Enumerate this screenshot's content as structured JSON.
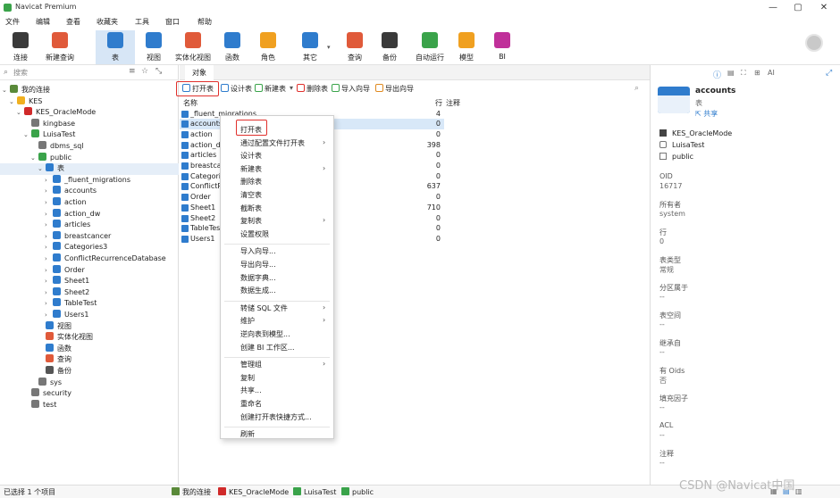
{
  "app": {
    "title": "Navicat Premium"
  },
  "menubar": [
    "文件",
    "编辑",
    "查看",
    "收藏夹",
    "工具",
    "窗口",
    "帮助"
  ],
  "toolbar": [
    {
      "label": "连接",
      "icon": "connection-plug-icon",
      "color": "#3a3a3a"
    },
    {
      "label": "新建查询",
      "icon": "new-query-icon",
      "color": "#e05a3a"
    },
    {
      "label": "表",
      "icon": "table-icon",
      "color": "#2f7ccd"
    },
    {
      "label": "视图",
      "icon": "view-glasses-icon",
      "color": "#2f7ccd"
    },
    {
      "label": "实体化视图",
      "icon": "materialized-view-icon",
      "color": "#e05a3a"
    },
    {
      "label": "函数",
      "icon": "function-fx-icon",
      "color": "#2f7ccd"
    },
    {
      "label": "角色",
      "icon": "role-user-icon",
      "color": "#f0a020"
    },
    {
      "label": "其它",
      "icon": "other-tools-icon",
      "color": "#2f7ccd"
    },
    {
      "label": "查询",
      "icon": "query-icon",
      "color": "#e05a3a"
    },
    {
      "label": "备份",
      "icon": "backup-icon",
      "color": "#3a3a3a"
    },
    {
      "label": "自动运行",
      "icon": "automation-robot-icon",
      "color": "#3aa34a"
    },
    {
      "label": "模型",
      "icon": "model-icon",
      "color": "#f0a020"
    },
    {
      "label": "BI",
      "icon": "bi-chart-icon",
      "color": "#c0309a"
    }
  ],
  "sidebar": {
    "search_placeholder": "搜索",
    "tree": [
      {
        "label": "我的连接",
        "level": 0,
        "chev": "v",
        "icon": "connections-icon",
        "color": "#5a8a3a"
      },
      {
        "label": "KES",
        "level": 1,
        "chev": "v",
        "icon": "folder-icon",
        "color": "#f0b020"
      },
      {
        "label": "KES_OracleMode",
        "level": 2,
        "chev": "v",
        "icon": "kes-server-icon",
        "color": "#d02a2a"
      },
      {
        "label": "kingbase",
        "level": 3,
        "chev": "",
        "icon": "database-icon",
        "color": "#777777"
      },
      {
        "label": "LuisaTest",
        "level": 3,
        "chev": "v",
        "icon": "database-icon",
        "color": "#3aa34a"
      },
      {
        "label": "dbms_sql",
        "level": 4,
        "chev": "",
        "icon": "schema-icon",
        "color": "#777777"
      },
      {
        "label": "public",
        "level": 4,
        "chev": "v",
        "icon": "schema-icon",
        "color": "#3aa34a"
      },
      {
        "label": "表",
        "level": 5,
        "chev": "v",
        "icon": "table-icon",
        "color": "#2f7ccd",
        "selected": true
      },
      {
        "label": "_fluent_migrations",
        "level": 6,
        "chev": ">",
        "icon": "table-icon",
        "color": "#2f7ccd"
      },
      {
        "label": "accounts",
        "level": 6,
        "chev": ">",
        "icon": "table-icon",
        "color": "#2f7ccd"
      },
      {
        "label": "action",
        "level": 6,
        "chev": ">",
        "icon": "table-icon",
        "color": "#2f7ccd"
      },
      {
        "label": "action_dw",
        "level": 6,
        "chev": ">",
        "icon": "table-icon",
        "color": "#2f7ccd"
      },
      {
        "label": "articles",
        "level": 6,
        "chev": ">",
        "icon": "table-icon",
        "color": "#2f7ccd"
      },
      {
        "label": "breastcancer",
        "level": 6,
        "chev": ">",
        "icon": "table-icon",
        "color": "#2f7ccd"
      },
      {
        "label": "Categories3",
        "level": 6,
        "chev": ">",
        "icon": "table-icon",
        "color": "#2f7ccd"
      },
      {
        "label": "ConflictRecurrenceDatabase",
        "level": 6,
        "chev": ">",
        "icon": "table-icon",
        "color": "#2f7ccd"
      },
      {
        "label": "Order",
        "level": 6,
        "chev": ">",
        "icon": "table-icon",
        "color": "#2f7ccd"
      },
      {
        "label": "Sheet1",
        "level": 6,
        "chev": ">",
        "icon": "table-icon",
        "color": "#2f7ccd"
      },
      {
        "label": "Sheet2",
        "level": 6,
        "chev": ">",
        "icon": "table-icon",
        "color": "#2f7ccd"
      },
      {
        "label": "TableTest",
        "level": 6,
        "chev": ">",
        "icon": "table-icon",
        "color": "#2f7ccd"
      },
      {
        "label": "Users1",
        "level": 6,
        "chev": ">",
        "icon": "table-icon",
        "color": "#2f7ccd"
      },
      {
        "label": "视图",
        "level": 5,
        "chev": "",
        "icon": "view-glasses-icon",
        "color": "#2f7ccd"
      },
      {
        "label": "实体化视图",
        "level": 5,
        "chev": "",
        "icon": "materialized-view-icon",
        "color": "#e05a3a"
      },
      {
        "label": "函数",
        "level": 5,
        "chev": "",
        "icon": "function-fx-icon",
        "color": "#2f7ccd"
      },
      {
        "label": "查询",
        "level": 5,
        "chev": "",
        "icon": "query-icon",
        "color": "#e05a3a"
      },
      {
        "label": "备份",
        "level": 5,
        "chev": "",
        "icon": "backup-icon",
        "color": "#555555"
      },
      {
        "label": "sys",
        "level": 4,
        "chev": "",
        "icon": "schema-icon",
        "color": "#777777"
      },
      {
        "label": "security",
        "level": 3,
        "chev": "",
        "icon": "database-icon",
        "color": "#777777"
      },
      {
        "label": "test",
        "level": 3,
        "chev": "",
        "icon": "database-icon",
        "color": "#777777"
      }
    ]
  },
  "main": {
    "tab": "对象",
    "objtoolbar": [
      {
        "label": "打开表",
        "icon": "open-table-icon",
        "color": "#2f7ccd"
      },
      {
        "label": "设计表",
        "icon": "design-table-icon",
        "color": "#2f7ccd"
      },
      {
        "label": "新建表",
        "icon": "new-table-icon",
        "color": "#3aa34a"
      },
      {
        "label": "删除表",
        "icon": "delete-table-icon",
        "color": "#e0302c"
      },
      {
        "label": "导入向导",
        "icon": "import-wizard-icon",
        "color": "#3aa34a"
      },
      {
        "label": "导出向导",
        "icon": "export-wizard-icon",
        "color": "#e08a20"
      }
    ],
    "col_name": "名称",
    "col_rows": "行",
    "col_comment": "注释",
    "rows": [
      {
        "name": "_fluent_migrations",
        "count": "4"
      },
      {
        "name": "accounts",
        "count": "0",
        "selected": true
      },
      {
        "name": "action",
        "count": "0"
      },
      {
        "name": "action_dw",
        "count": "398"
      },
      {
        "name": "articles",
        "count": "0"
      },
      {
        "name": "breastcancer",
        "count": "0"
      },
      {
        "name": "Categories3",
        "count": "0"
      },
      {
        "name": "ConflictRecurrenceDatabase",
        "count": "637"
      },
      {
        "name": "Order",
        "count": "0"
      },
      {
        "name": "Sheet1",
        "count": "710"
      },
      {
        "name": "Sheet2",
        "count": "0"
      },
      {
        "name": "TableTest",
        "count": "0"
      },
      {
        "name": "Users1",
        "count": "0"
      }
    ]
  },
  "context_menu": [
    {
      "label": "打开表"
    },
    {
      "label": "通过配置文件打开表",
      "submenu": true
    },
    {
      "label": "设计表"
    },
    {
      "label": "新建表",
      "submenu": true
    },
    {
      "label": "删除表"
    },
    {
      "label": "清空表"
    },
    {
      "label": "截断表"
    },
    {
      "label": "复制表",
      "submenu": true
    },
    {
      "label": "设置权限"
    },
    {
      "sep": true
    },
    {
      "label": "导入向导..."
    },
    {
      "label": "导出向导..."
    },
    {
      "label": "数据字典..."
    },
    {
      "label": "数据生成..."
    },
    {
      "sep": true
    },
    {
      "label": "转储 SQL 文件",
      "submenu": true
    },
    {
      "label": "维护",
      "submenu": true
    },
    {
      "label": "逆向表到模型..."
    },
    {
      "label": "创建 BI 工作区..."
    },
    {
      "sep": true
    },
    {
      "label": "管理组",
      "submenu": true
    },
    {
      "label": "复制"
    },
    {
      "label": "共享..."
    },
    {
      "label": "重命名"
    },
    {
      "label": "创建打开表快捷方式..."
    },
    {
      "sep": true
    },
    {
      "label": "刷新"
    }
  ],
  "right_panel": {
    "object_name": "accounts",
    "object_type": "表",
    "share_label": "共享",
    "server": "KES_OracleMode",
    "database": "LuisaTest",
    "schema": "public",
    "props": [
      {
        "label": "OID",
        "value": "16717"
      },
      {
        "label": "所有者",
        "value": "system"
      },
      {
        "label": "行",
        "value": "0"
      },
      {
        "label": "表类型",
        "value": "常规"
      },
      {
        "label": "分区属于",
        "value": "--"
      },
      {
        "label": "表空间",
        "value": "--"
      },
      {
        "label": "继承自",
        "value": "--"
      },
      {
        "label": "有 Oids",
        "value": "否"
      },
      {
        "label": "填充因子",
        "value": "--"
      },
      {
        "label": "ACL",
        "value": "--"
      },
      {
        "label": "注释",
        "value": "--"
      }
    ]
  },
  "statusbar": {
    "selected": "已选择 1 个项目",
    "crumbs": [
      {
        "label": "我的连接",
        "icon": "connections-icon",
        "color": "#5a8a3a"
      },
      {
        "label": "KES_OracleMode",
        "icon": "kes-server-icon",
        "color": "#d02a2a"
      },
      {
        "label": "LuisaTest",
        "icon": "database-icon",
        "color": "#3aa34a"
      },
      {
        "label": "public",
        "icon": "schema-icon",
        "color": "#3aa34a"
      }
    ]
  },
  "watermark": "CSDN @Navicat中国"
}
